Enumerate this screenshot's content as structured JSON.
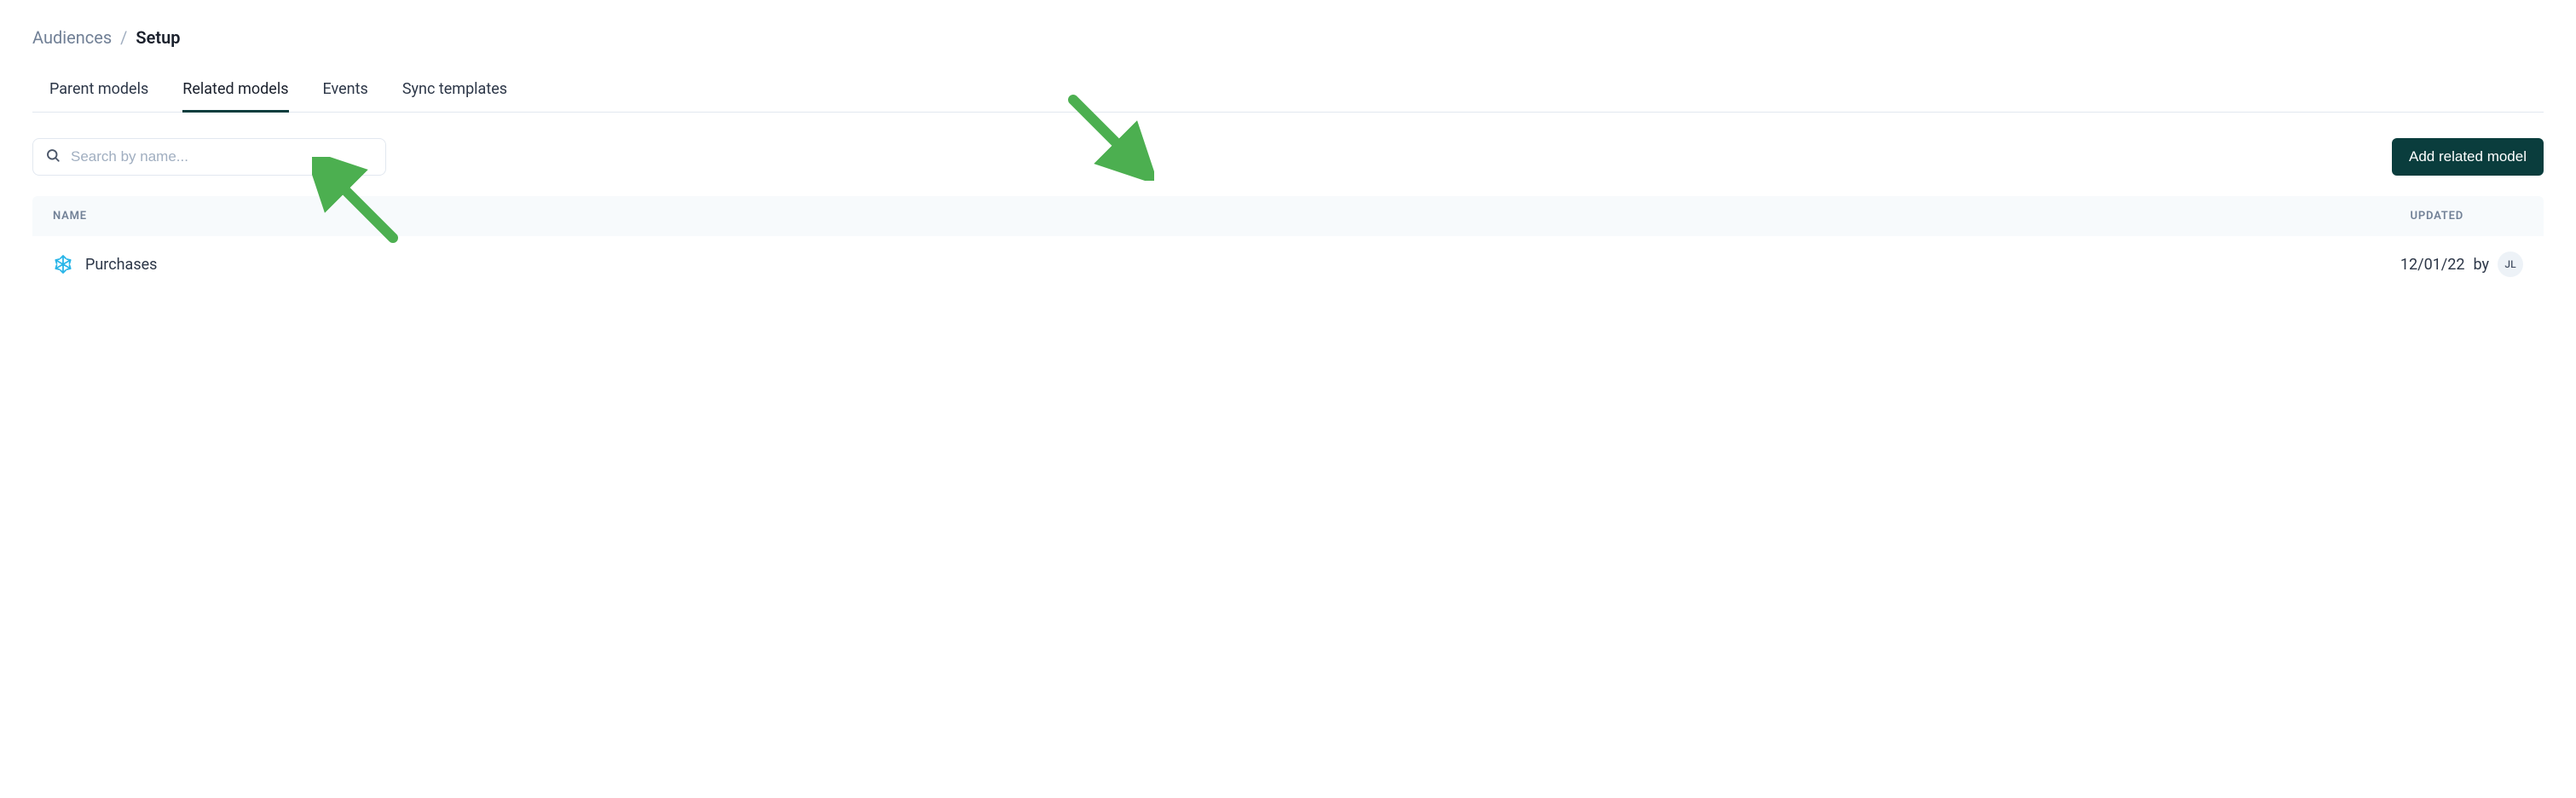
{
  "breadcrumb": {
    "parent": "Audiences",
    "separator": "/",
    "current": "Setup"
  },
  "tabs": [
    {
      "label": "Parent models",
      "active": false
    },
    {
      "label": "Related models",
      "active": true
    },
    {
      "label": "Events",
      "active": false
    },
    {
      "label": "Sync templates",
      "active": false
    }
  ],
  "search": {
    "placeholder": "Search by name..."
  },
  "actions": {
    "add_label": "Add related model"
  },
  "table": {
    "columns": {
      "name": "NAME",
      "updated": "UPDATED"
    },
    "rows": [
      {
        "icon": "snowflake-icon",
        "name": "Purchases",
        "updated_date": "12/01/22",
        "updated_by_word": "by",
        "updated_by_initials": "JL"
      }
    ]
  },
  "annotations": {
    "arrow_color": "#4caf50"
  }
}
